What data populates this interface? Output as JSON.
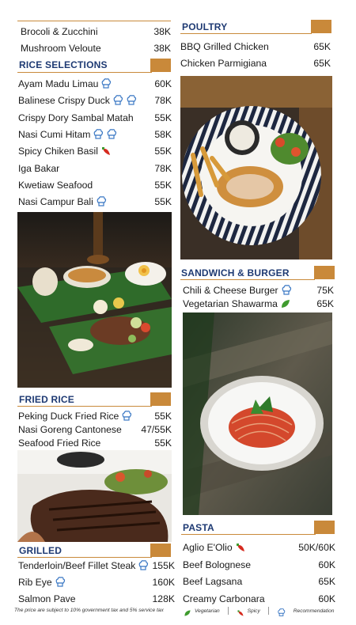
{
  "left_top_items": [
    {
      "name": "Brocoli & Zucchini",
      "price": "38K"
    },
    {
      "name": "Mushroom Veloute",
      "price": "38K"
    }
  ],
  "rice": {
    "title": "RICE SELECTIONS",
    "items": [
      {
        "name": "Ayam Madu Limau",
        "price": "60K",
        "icons": [
          "chef-hat"
        ]
      },
      {
        "name": "Balinese Crispy Duck",
        "price": "78K",
        "icons": [
          "chef-hat",
          "chef-hat"
        ]
      },
      {
        "name": "Crispy Dory Sambal Matah",
        "price": "55K",
        "icons": []
      },
      {
        "name": "Nasi Cumi Hitam",
        "price": "58K",
        "icons": [
          "chef-hat",
          "chef-hat"
        ]
      },
      {
        "name": "Spicy Chiken Basil",
        "price": "55K",
        "icons": [
          "chili"
        ]
      },
      {
        "name": "Iga Bakar",
        "price": "78K",
        "icons": []
      },
      {
        "name": "Kwetiaw Seafood",
        "price": "55K",
        "icons": []
      },
      {
        "name": "Nasi Campur Bali",
        "price": "55K",
        "icons": [
          "chef-hat"
        ]
      }
    ]
  },
  "fried_rice": {
    "title": "FRIED RICE",
    "items": [
      {
        "name": "Peking Duck Fried Rice",
        "price": "55K",
        "icons": [
          "chef-hat"
        ]
      },
      {
        "name": "Nasi Goreng Cantonese",
        "price": "47/55K",
        "icons": []
      },
      {
        "name": "Seafood Fried Rice",
        "price": "55K",
        "icons": []
      }
    ]
  },
  "grilled": {
    "title": "GRILLED",
    "items": [
      {
        "name": "Tenderloin/Beef Fillet Steak",
        "price": "155K",
        "icons": [
          "chef-hat"
        ]
      },
      {
        "name": "Rib Eye",
        "price": "160K",
        "icons": [
          "chef-hat"
        ]
      },
      {
        "name": "Salmon Pave",
        "price": "128K",
        "icons": []
      }
    ]
  },
  "poultry": {
    "title": "POULTRY",
    "items": [
      {
        "name": "BBQ Grilled Chicken",
        "price": "65K",
        "icons": []
      },
      {
        "name": "Chicken Parmigiana",
        "price": "65K",
        "icons": []
      }
    ]
  },
  "sandwich": {
    "title": "SANDWICH & BURGER",
    "items": [
      {
        "name": "Chili & Cheese Burger",
        "price": "75K",
        "icons": [
          "chef-hat"
        ]
      },
      {
        "name": "Vegetarian Shawarma",
        "price": "65K",
        "icons": [
          "leaf"
        ]
      }
    ]
  },
  "pasta": {
    "title": "PASTA",
    "items": [
      {
        "name": "Aglio E'Olio",
        "price": "50K/60K",
        "icons": [
          "chili"
        ]
      },
      {
        "name": "Beef Bolognese",
        "price": "60K",
        "icons": []
      },
      {
        "name": "Beef Lagsana",
        "price": "65K",
        "icons": []
      },
      {
        "name": "Creamy Carbonara",
        "price": "60K",
        "icons": []
      }
    ]
  },
  "footer": {
    "tax_note": "The price are subject to 10% government tax and 5% service tax",
    "legend_vegetarian": "Vegetarian",
    "legend_spicy": "Spicy",
    "legend_recommendation": "Recommendation"
  },
  "colors": {
    "accent": "#c9893a",
    "heading": "#1e3a73",
    "chili": "#d62b1f",
    "leaf": "#3f9b2e",
    "chef_hat": "#3b78c4"
  }
}
